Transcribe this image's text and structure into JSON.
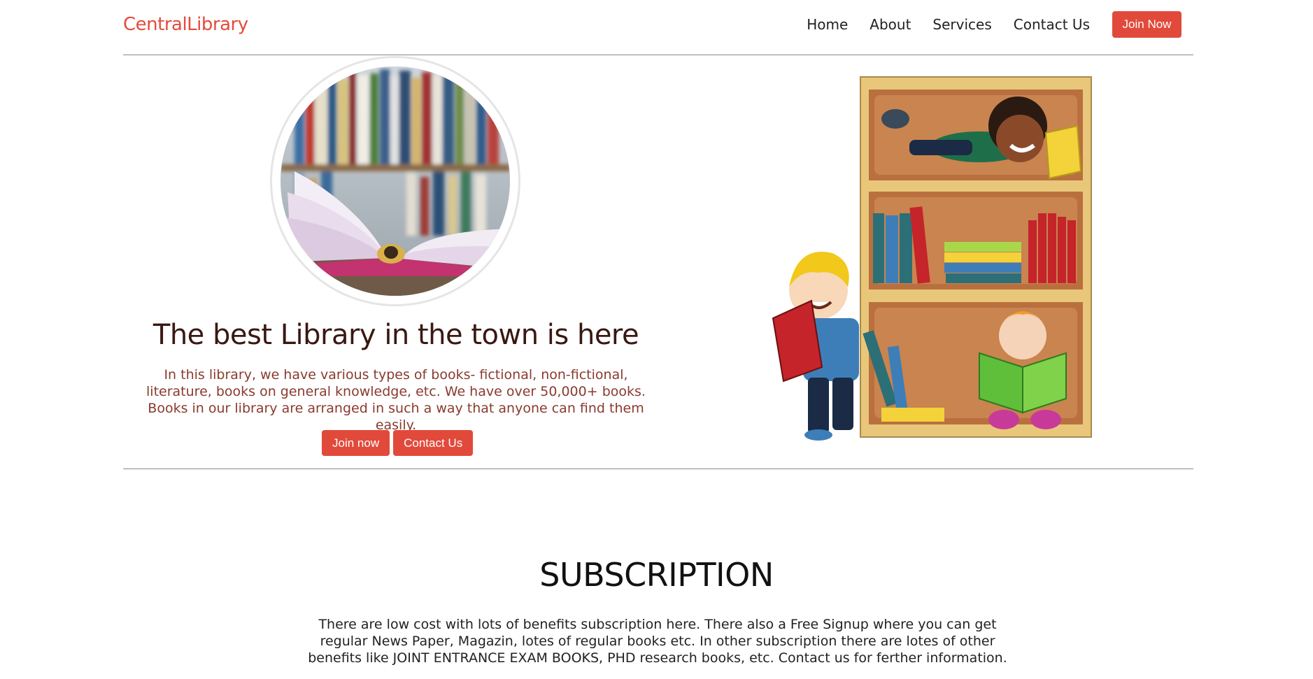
{
  "brand": "CentralLibrary",
  "nav": {
    "links": [
      "Home",
      "About",
      "Services",
      "Contact Us"
    ],
    "join_label": "Join Now"
  },
  "hero": {
    "title": "The best Library in the town is here",
    "description": "In this library, we have various types of books- fictional, non-fictional, literature, books on general knowledge, etc. We have over 50,000+ books. Books in our library are arranged in such a way that anyone can find them easily.",
    "join_label": "Join now",
    "contact_label": "Contact Us"
  },
  "subscription": {
    "title": "SUBSCRIPTION",
    "description": "There are low cost with lots of benefits subscription here. There also a Free Signup where you can get regular News Paper, Magazin, lotes of regular books etc. In other subscription there are lotes of other benefits like JOINT ENTRANCE EXAM BOOKS, PHD research books, etc. Contact us for ferther information."
  },
  "colors": {
    "accent": "#e14a3b",
    "brand": "#e54b3c",
    "hero_title": "#3a1812",
    "hero_text": "#8a3a2e"
  }
}
